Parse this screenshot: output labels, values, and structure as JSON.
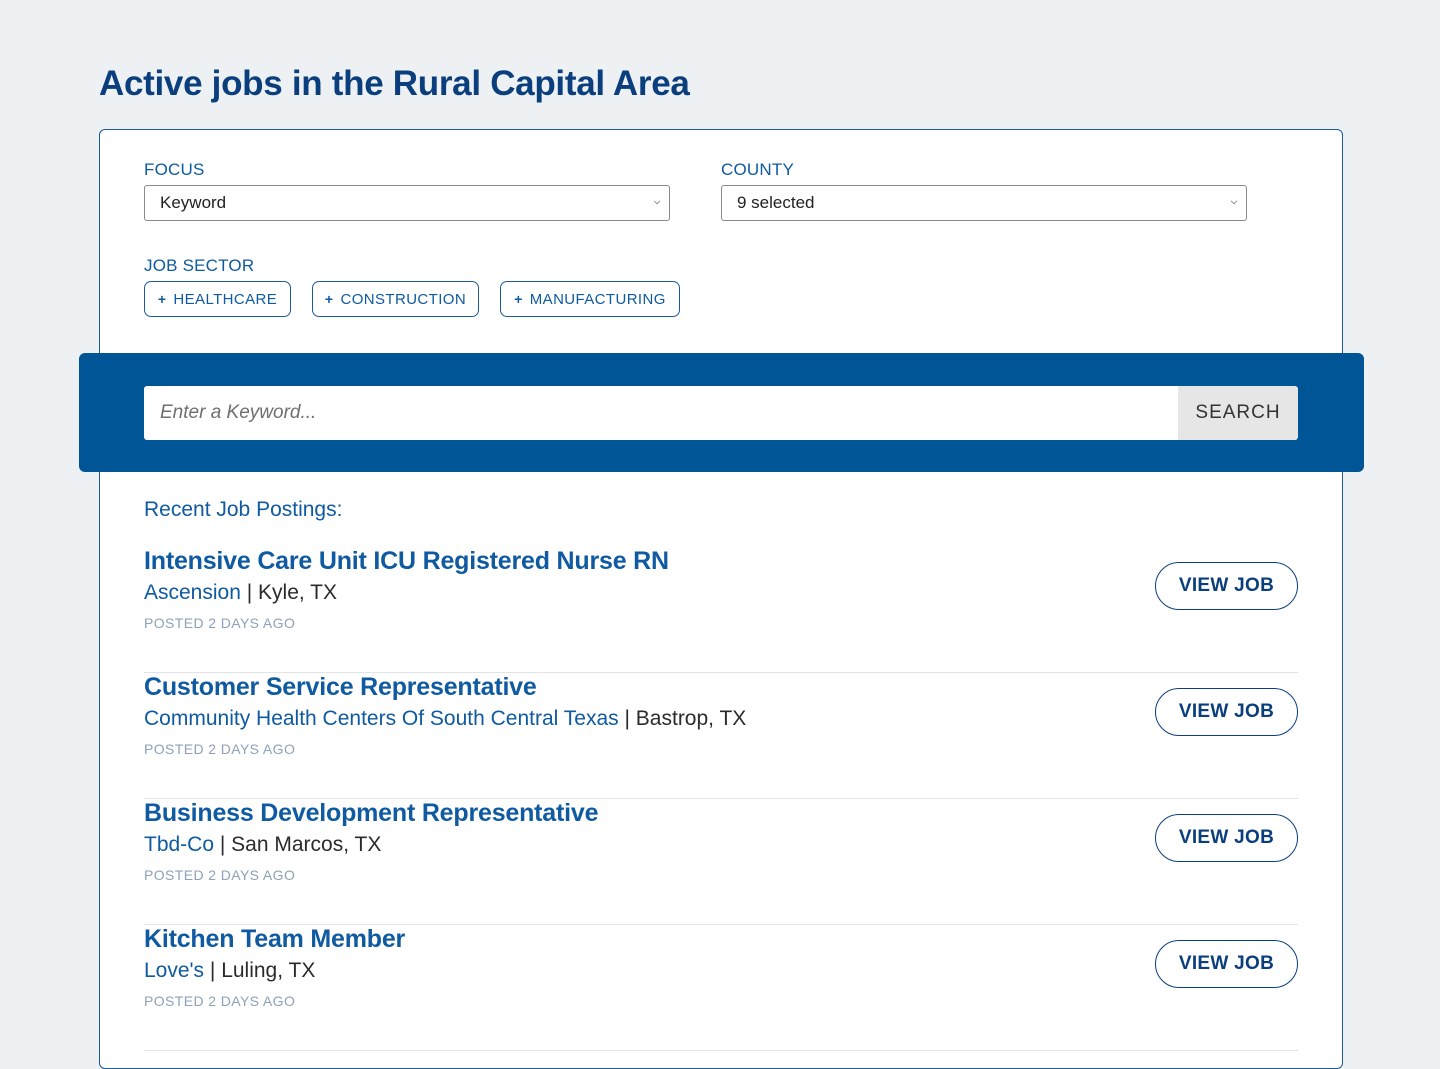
{
  "page": {
    "title": "Active jobs in the Rural Capital Area"
  },
  "filters": {
    "focus": {
      "label": "FOCUS",
      "value": "Keyword"
    },
    "county": {
      "label": "COUNTY",
      "value": "9 selected"
    },
    "job_sector": {
      "label": "JOB SECTOR",
      "chips": [
        {
          "label": "HEALTHCARE"
        },
        {
          "label": "CONSTRUCTION"
        },
        {
          "label": "MANUFACTURING"
        }
      ]
    }
  },
  "search": {
    "placeholder": "Enter a Keyword...",
    "button_label": "SEARCH"
  },
  "recent": {
    "heading": "Recent Job Postings:",
    "view_label": "VIEW JOB",
    "jobs": [
      {
        "title": "Intensive Care Unit ICU Registered Nurse RN",
        "company": "Ascension",
        "location": "Kyle, TX",
        "posted": "POSTED 2 DAYS AGO"
      },
      {
        "title": "Customer Service Representative",
        "company": "Community Health Centers Of South Central Texas",
        "location": "Bastrop, TX",
        "posted": "POSTED 2 DAYS AGO"
      },
      {
        "title": "Business Development Representative",
        "company": "Tbd-Co",
        "location": "San Marcos, TX",
        "posted": "POSTED 2 DAYS AGO"
      },
      {
        "title": "Kitchen Team Member",
        "company": "Love's",
        "location": "Luling, TX",
        "posted": "POSTED 2 DAYS AGO"
      }
    ]
  },
  "colors": {
    "brand_dark": "#0a3e7c",
    "brand": "#0f5aa0",
    "search_band": "#005596",
    "background": "#edf1f3"
  }
}
